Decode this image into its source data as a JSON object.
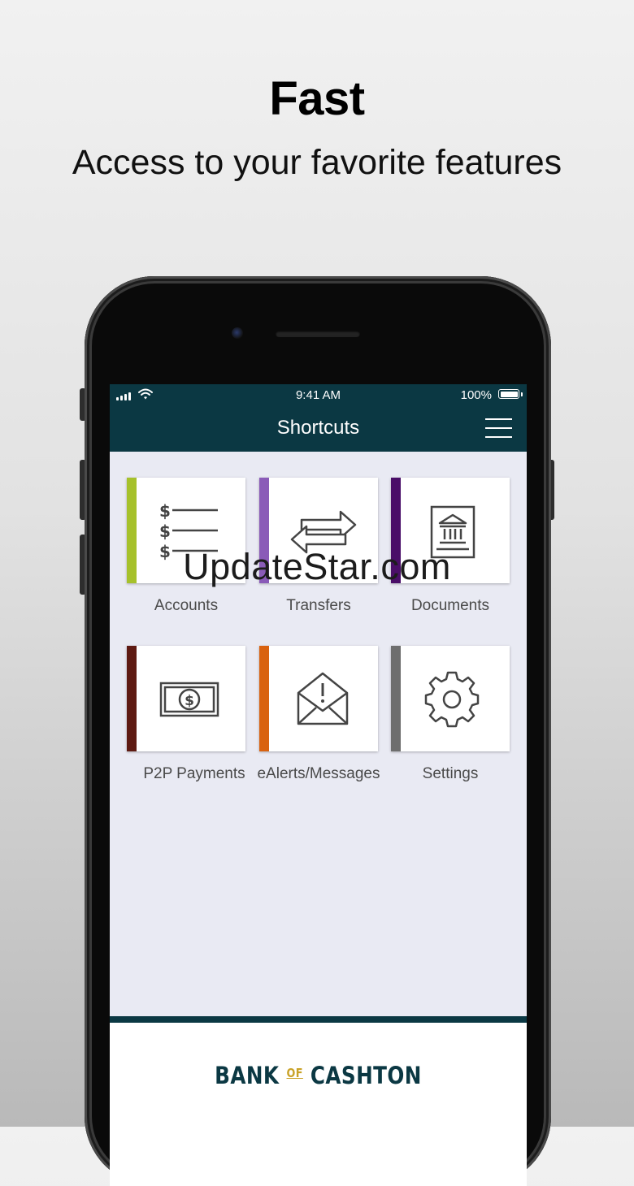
{
  "hero": {
    "title": "Fast",
    "subtitle": "Access to your favorite features"
  },
  "status_bar": {
    "time": "9:41 AM",
    "battery": "100%"
  },
  "navbar": {
    "title": "Shortcuts",
    "menu_icon": "hamburger-menu-icon"
  },
  "shortcuts": [
    {
      "label": "Accounts",
      "icon": "dollar-list-icon",
      "color": "#a6c12b"
    },
    {
      "label": "Transfers",
      "icon": "transfer-arrows-icon",
      "color": "#8a5bb8"
    },
    {
      "label": "Documents",
      "icon": "bank-document-icon",
      "color": "#4a0e68"
    },
    {
      "label": "P2P Payments",
      "icon": "dollar-bill-icon",
      "color": "#5e1a12"
    },
    {
      "label": "eAlerts/Messages",
      "icon": "alert-envelope-icon",
      "color": "#d9620f"
    },
    {
      "label": "Settings",
      "icon": "gear-icon",
      "color": "#6e6e6e"
    }
  ],
  "footer": {
    "logo_text_1": "BANK",
    "logo_text_2": "OF",
    "logo_text_3": "CASHTON"
  },
  "watermark": "UpdateStar.com",
  "colors": {
    "brand": "#0b3843",
    "screen_background": "#e9eaf3",
    "logo_accent": "#c9a227"
  }
}
